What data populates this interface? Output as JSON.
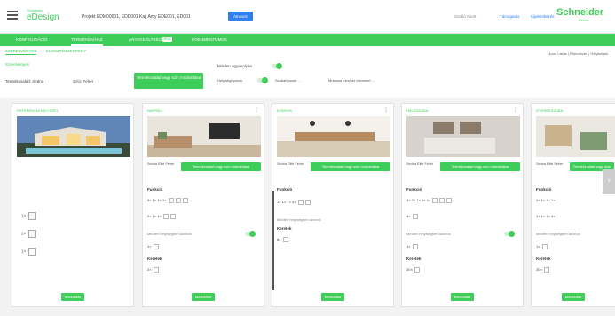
{
  "header": {
    "logo_small": "Schneider",
    "logo_big": "eDesign",
    "project": "Projekt EDM00001, EDD001 Kaji Amy EDE001, ED001",
    "rename_label": "Átnevez",
    "user": "Szabó Anett",
    "link1": "Támogatás",
    "link2": "Kijelentkezés",
    "brand": "Schneider",
    "brand_sub": "Electric"
  },
  "main_tabs": [
    {
      "label": "KONFIGURÁCIÓ"
    },
    {
      "label": "TERMÉKEK/HÁZ"
    },
    {
      "label": "ANYAGKÖLTSÉG",
      "badge": "PRO"
    },
    {
      "label": "DOKUMENTUMOK"
    }
  ],
  "sub_tabs": [
    {
      "label": "SZERELVÉNYEK"
    },
    {
      "label": "ELOSZTÓSZEKRÉNY"
    }
  ],
  "types_right": "Típus: Lakás | Elrendezés | Helyiségek",
  "filters": {
    "section_label": "Szerelvények",
    "product_label": "Termékcsalád: Sedna",
    "color_label": "Szín: Fehér",
    "replace_btn": "Termékcsalád vagy szín módosítása",
    "same_label": "Minden ugyanolyan",
    "room_label": "Helyiségtípusok",
    "drop1": "Szobatípusok ...",
    "drop2": "Mutassa mind az elemeket ..."
  },
  "cards": [
    {
      "title": "Referencia helyiség",
      "reference": true,
      "rows": [
        "1×",
        "2×",
        "1×"
      ],
      "modify": "Módosítás"
    },
    {
      "title": "Nappali",
      "status": "Sedna Elité Fehér",
      "button": "Termékcsalád vagy szín módosítása",
      "function": "Funkció",
      "rows": [
        "3× 1× 1× 1×",
        "2× 1× 4×"
      ],
      "opt": "Minden helyiségben azonos",
      "row3": "1×",
      "frame": "Keretek",
      "frame_row": "2×",
      "modify": "Módosítás"
    },
    {
      "title": "Konyha",
      "status": "Sedna Elité Fehér",
      "button": "Termékcsalád vagy szín módosítása",
      "function": "Funkció",
      "rows": [
        "1× 1× 1× 4×"
      ],
      "opt": "Minden helyiségben azonos",
      "row3": "",
      "frame": "Keretek",
      "frame_row": "6×",
      "modify": "Módosítás"
    },
    {
      "title": "Hálószoba",
      "status": "Sedna Elité Fehér",
      "button": "Termékcsalád vagy szín módosítása",
      "function": "Funkció",
      "rows": [
        "1× 2× 1× 1× 1×",
        "4×"
      ],
      "opt": "Minden helyiségben azonos",
      "row3": "1×",
      "frame": "Keretek",
      "frame_row": "20×",
      "modify": "Módosítás"
    },
    {
      "title": "Gyerekszoba",
      "status": "Sedna Elité Fehér",
      "button": "Termékcsalád vagy szín módosítása",
      "function": "Funkció",
      "rows": [
        "1× 1× 1× 1×",
        "1× 1× 1× 4×"
      ],
      "opt": "Minden helyiségben azonos",
      "row3": "1×",
      "frame": "Keretek",
      "frame_row": "20×",
      "modify": "Módosítás"
    }
  ],
  "colors": {
    "green": "#3dcd58",
    "blue": "#2f80ed"
  }
}
